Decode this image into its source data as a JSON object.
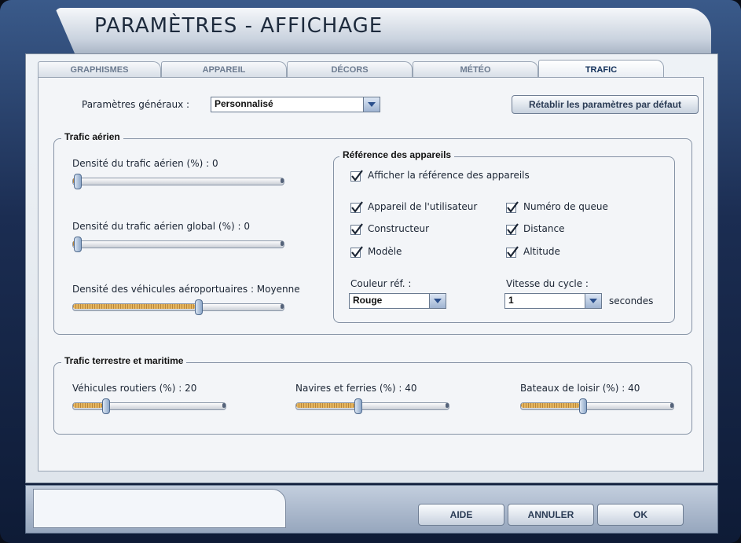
{
  "window": {
    "title": "PARAMÈTRES - AFFICHAGE"
  },
  "tabs": [
    {
      "label": "GRAPHISMES"
    },
    {
      "label": "APPAREIL"
    },
    {
      "label": "DÉCORS"
    },
    {
      "label": "MÉTÉO"
    },
    {
      "label": "TRAFIC",
      "active": true
    }
  ],
  "general": {
    "label": "Paramètres généraux :",
    "value": "Personnalisé",
    "reset_label": "Rétablir les paramètres par défaut"
  },
  "air": {
    "title": "Trafic aérien",
    "density_label": "Densité du trafic aérien (%) : 0",
    "density_value": 0,
    "global_label": "Densité du trafic aérien global (%) : 0",
    "global_value": 0,
    "vehicles_label": "Densité des véhicules aéroportuaires : Moyenne",
    "vehicles_value": 0.6
  },
  "labels": {
    "title": "Référence des appareils",
    "show": "Afficher la référence des appareils",
    "user_aircraft": "Appareil de l'utilisateur",
    "tail_number": "Numéro de queue",
    "manufacturer": "Constructeur",
    "distance": "Distance",
    "model": "Modèle",
    "altitude": "Altitude",
    "color_label": "Couleur réf. :",
    "color_value": "Rouge",
    "cycle_label": "Vitesse du cycle :",
    "cycle_value": "1",
    "cycle_unit": "secondes"
  },
  "ground": {
    "title": "Trafic terrestre et maritime",
    "road_label": "Véhicules routiers (%) : 20",
    "road_value": 0.2,
    "ships_label": "Navires et ferries (%) : 40",
    "ships_value": 0.4,
    "boats_label": "Bateaux de loisir (%) : 40",
    "boats_value": 0.4
  },
  "footer": {
    "help": "AIDE",
    "cancel": "ANNULER",
    "ok": "OK"
  }
}
